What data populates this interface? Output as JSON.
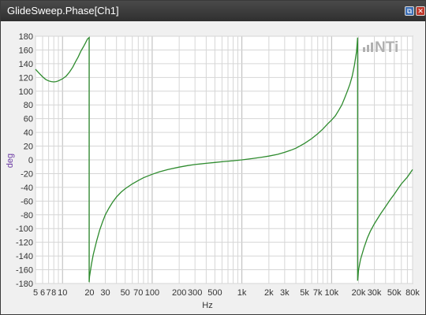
{
  "window": {
    "title": "GlideSweep.Phase[Ch1]"
  },
  "controls": {
    "restore_icon": "restore-window-icon",
    "close_icon": "close-window-icon",
    "restore_glyph": "⧉",
    "close_glyph": "✕"
  },
  "brand": {
    "logo_text": "NTi"
  },
  "chart_data": {
    "type": "line",
    "xlabel": "Hz",
    "ylabel": "deg",
    "xscale": "log",
    "xlim": [
      5,
      80000
    ],
    "ylim": [
      -180,
      180
    ],
    "grid": true,
    "x_tick_labels": [
      {
        "v": 5,
        "t": "5"
      },
      {
        "v": 6,
        "t": "6"
      },
      {
        "v": 7,
        "t": "7"
      },
      {
        "v": 8,
        "t": "8"
      },
      {
        "v": 10,
        "t": "10"
      },
      {
        "v": 20,
        "t": "20"
      },
      {
        "v": 30,
        "t": "30"
      },
      {
        "v": 50,
        "t": "50"
      },
      {
        "v": 70,
        "t": "70"
      },
      {
        "v": 100,
        "t": "100"
      },
      {
        "v": 200,
        "t": "200"
      },
      {
        "v": 300,
        "t": "300"
      },
      {
        "v": 500,
        "t": "500"
      },
      {
        "v": 1000,
        "t": "1k"
      },
      {
        "v": 2000,
        "t": "2k"
      },
      {
        "v": 3000,
        "t": "3k"
      },
      {
        "v": 5000,
        "t": "5k"
      },
      {
        "v": 7000,
        "t": "7k"
      },
      {
        "v": 10000,
        "t": "10k"
      },
      {
        "v": 20000,
        "t": "20k"
      },
      {
        "v": 30000,
        "t": "30k"
      },
      {
        "v": 50000,
        "t": "50k"
      },
      {
        "v": 80000,
        "t": "80k"
      }
    ],
    "y_ticks": [
      180,
      160,
      140,
      120,
      100,
      80,
      60,
      40,
      20,
      0,
      -20,
      -40,
      -60,
      -80,
      -100,
      -120,
      -140,
      -160,
      -180
    ],
    "series_color": "#2e8b2e",
    "series": [
      {
        "x": [
          5,
          5.5,
          6,
          6.5,
          7,
          7.5,
          8,
          8.5,
          9,
          10,
          11,
          12,
          13,
          14,
          15,
          16,
          17,
          18,
          19,
          19.8,
          19.8,
          20,
          21,
          22,
          24,
          26,
          28,
          30,
          33,
          36,
          40,
          45,
          50,
          60,
          70,
          80,
          100,
          120,
          150,
          200,
          250,
          300,
          400,
          500,
          600,
          800,
          1000,
          1300,
          1700,
          2000,
          2500,
          3000,
          3500,
          4000,
          5000,
          6000,
          7000,
          8000,
          9000,
          10000,
          11000,
          12000,
          13000,
          14000,
          15000,
          16000,
          17000,
          18000,
          19000,
          19500,
          19500,
          20000,
          21000,
          23000,
          25000,
          27000,
          30000,
          35000,
          40000,
          45000,
          50000,
          55000,
          60000,
          70000,
          80000
        ],
        "y": [
          132,
          126,
          121,
          117,
          115,
          114,
          113.5,
          114,
          115,
          118,
          122,
          128,
          135,
          143,
          150,
          158,
          164,
          170,
          176,
          178,
          -178,
          -170,
          -152,
          -138,
          -118,
          -102,
          -90,
          -80,
          -70,
          -62,
          -54,
          -47,
          -42,
          -35,
          -30,
          -26,
          -21,
          -17.5,
          -14,
          -10.5,
          -8.2,
          -6.8,
          -5,
          -3.8,
          -2.8,
          -1.3,
          0,
          1.8,
          4,
          5.5,
          8,
          11,
          14,
          17,
          24,
          31,
          38,
          45,
          52,
          58,
          64,
          72,
          80,
          90,
          100,
          110,
          122,
          138,
          158,
          178,
          -176,
          -160,
          -145,
          -128,
          -114,
          -104,
          -93,
          -79,
          -68,
          -58,
          -50,
          -42,
          -35,
          -25,
          -14
        ]
      }
    ]
  }
}
